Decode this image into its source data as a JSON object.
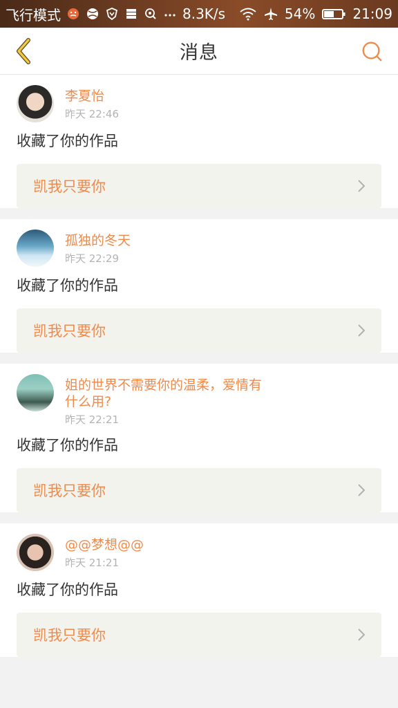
{
  "status_bar": {
    "mode": "飞行模式",
    "speed": "8.3K/s",
    "battery": "54%",
    "time": "21:09",
    "icons": [
      "face-icon",
      "ball-icon",
      "shield-icon",
      "storage-icon",
      "wifi-loc-icon",
      "more-dots-icon",
      "wifi-icon",
      "airplane-icon",
      "battery-icon"
    ]
  },
  "nav": {
    "title": "消息",
    "back_icon": "back-chevron-icon",
    "search_icon": "search-icon"
  },
  "colors": {
    "accent": "#f08a4b",
    "nav_icon": "#f5c842",
    "text": "#333333",
    "muted": "#b3b3b3",
    "card_box": "#f3f3ee"
  },
  "messages": [
    {
      "username": "李夏怡",
      "time": "昨天 22:46",
      "action": "收藏了你的作品",
      "work": "凯我只要你"
    },
    {
      "username": "孤独的冬天",
      "time": "昨天 22:29",
      "action": "收藏了你的作品",
      "work": "凯我只要你"
    },
    {
      "username": "姐的世界不需要你的温柔，爱情有什么用?",
      "time": "昨天 22:21",
      "action": "收藏了你的作品",
      "work": "凯我只要你"
    },
    {
      "username": "@@梦想@@",
      "time": "昨天 21:21",
      "action": "收藏了你的作品",
      "work": "凯我只要你"
    }
  ]
}
